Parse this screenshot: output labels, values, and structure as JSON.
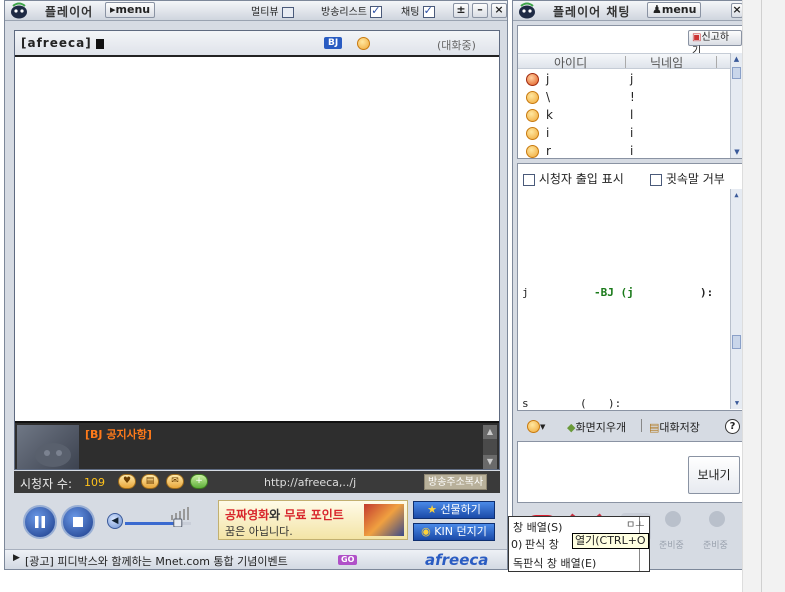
{
  "player": {
    "title": "플레이어",
    "menu": "menu",
    "toggles": [
      {
        "label": "멀티뷰",
        "checked": false
      },
      {
        "label": "방송리스트",
        "checked": true
      },
      {
        "label": "채팅",
        "checked": true
      }
    ],
    "window_buttons": [
      "±",
      "–",
      "×"
    ],
    "channel": "[afreeca]",
    "bj_badge": "BJ",
    "status": "(대화중)",
    "notice_label": "[BJ 공지사항]",
    "viewer_label": "시청자 수:",
    "viewer_count": "109",
    "url": "http://afreeca,../j",
    "copy_url": "방송주소복사",
    "volume_level": 0.8,
    "ad_line1a": "공짜영화",
    "ad_line1b": "와 ",
    "ad_line1c": "무료 포인트",
    "ad_line2": "꿈은 아닙니다.",
    "gift_button": "선물하기",
    "kin_button": "KIN 던지기",
    "ticker": "[광고] 피디박스와 함께하는 Mnet.com 통합 기념이벤트",
    "ticker_go": "GO",
    "brand": "afreeca"
  },
  "chat": {
    "title": "플레이어 채팅",
    "menu": "menu",
    "report": "신고하기",
    "col_id": "아이디",
    "col_nick": "닉네임",
    "users": [
      {
        "id": "j",
        "nick": "j"
      },
      {
        "id": "\\",
        "nick": "!"
      },
      {
        "id": "k",
        "nick": "l"
      },
      {
        "id": "i",
        "nick": "i"
      },
      {
        "id": "r",
        "nick": "i"
      }
    ],
    "show_entry": "시청자 출입 표시",
    "refuse_whisper": "귓속말 거부",
    "msg_user": "j",
    "msg_bj": "-BJ (j",
    "msg_tail": "):",
    "bottom_s": "s",
    "bottom_paren": "(",
    "bottom_tail": "):",
    "clear": "화면지우개",
    "save": "대화저장",
    "help": "?",
    "send": "보내기",
    "prepare": [
      "준비중",
      "준비중"
    ]
  },
  "context_menu": {
    "items": [
      "창 배열(S)",
      "판식 창",
      "독판식 창 배열(E)"
    ],
    "tooltip": "열기(CTRL+O",
    "tooltip_prefix": "0)",
    "side_tip": "ㅁㅗ"
  }
}
